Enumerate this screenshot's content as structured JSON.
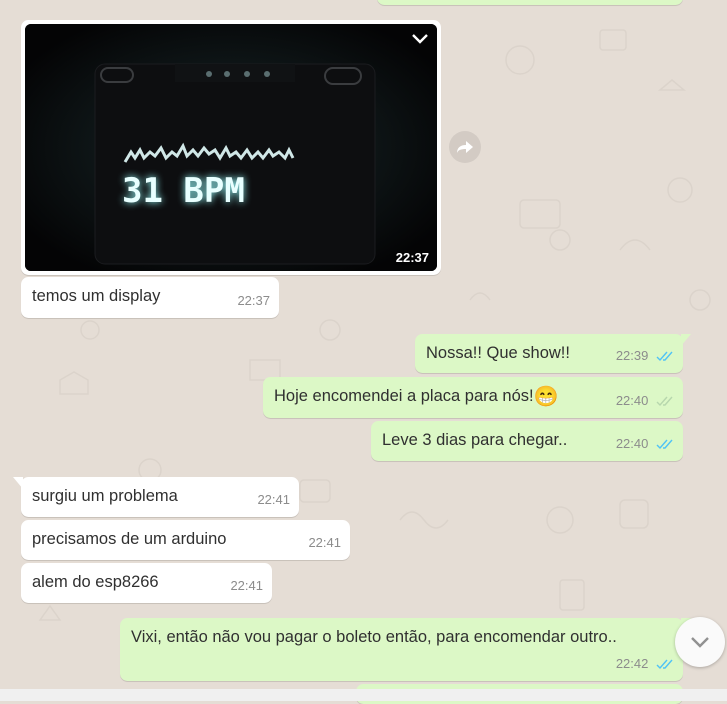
{
  "messages": [
    {
      "id": "m1",
      "dir": "in",
      "text": "temos um display",
      "time": "22:37"
    },
    {
      "id": "m2",
      "dir": "out",
      "text": "Nossa!! Que show!!",
      "time": "22:39",
      "status": "read"
    },
    {
      "id": "m3",
      "dir": "out",
      "text": "Hoje encomendei a placa para nós!",
      "emoji": "😁",
      "time": "22:40",
      "status": "pending"
    },
    {
      "id": "m4",
      "dir": "out",
      "text": "Leve 3 dias para chegar..",
      "time": "22:40",
      "status": "read"
    },
    {
      "id": "m5",
      "dir": "in",
      "text": "surgiu um problema",
      "time": "22:41"
    },
    {
      "id": "m6",
      "dir": "in",
      "text": "precisamos de um arduino",
      "time": "22:41"
    },
    {
      "id": "m7",
      "dir": "in",
      "text": "alem do esp8266",
      "time": "22:41"
    },
    {
      "id": "m8",
      "dir": "out",
      "text": "Vixi, então não vou pagar o boleto então, para encomendar outro..",
      "time": "22:42",
      "status": "read"
    }
  ],
  "media": {
    "time": "22:37",
    "display_bpm_text": "31 BPM"
  },
  "icons": {
    "forward": "forward-arrow-icon",
    "scroll_down": "chevron-down-icon",
    "media_menu": "chevron-down-icon",
    "read": "double-check-icon"
  },
  "colors": {
    "background": "#e5ddd5",
    "incoming": "#ffffff",
    "outgoing": "#dcf8c6",
    "read_ticks": "#4fc3f7",
    "meta": "#8c8c8c"
  }
}
